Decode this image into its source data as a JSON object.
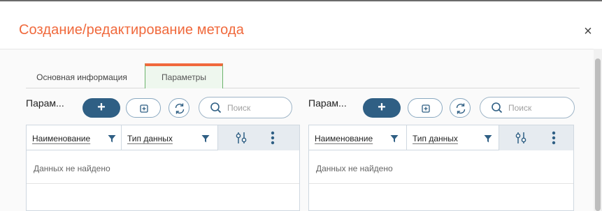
{
  "dialog": {
    "title": "Создание/редактирование метода",
    "close_symbol": "×"
  },
  "tabs": [
    {
      "label": "Основная информация",
      "active": false
    },
    {
      "label": "Параметры",
      "active": true
    }
  ],
  "panels": [
    {
      "label": "Парам...",
      "add_symbol": "+",
      "search_placeholder": "Поиск",
      "columns": [
        "Наименование",
        "Тип данных"
      ],
      "empty_text": "Данных не найдено"
    },
    {
      "label": "Парам...",
      "add_symbol": "+",
      "search_placeholder": "Поиск",
      "columns": [
        "Наименование",
        "Тип данных"
      ],
      "empty_text": "Данных не найдено"
    }
  ],
  "icons": [
    "close-icon",
    "plus-icon",
    "expand-icon",
    "refresh-icon",
    "search-icon",
    "filter-icon",
    "column-settings-icon",
    "more-vertical-icon"
  ],
  "colors": {
    "title": "#f0693c",
    "primary_button": "#2f5f84",
    "active_tab_accent": "#f0693c",
    "active_tab_border": "#6bb36b",
    "filter_icon": "#2f5f84"
  }
}
